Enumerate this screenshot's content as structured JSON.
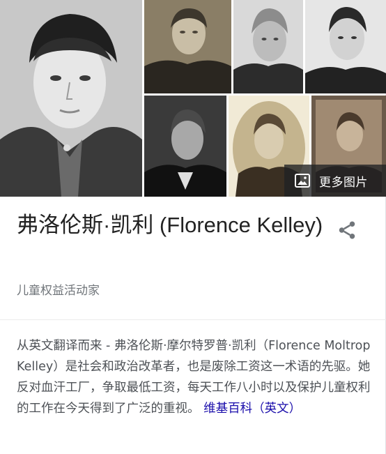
{
  "entity": {
    "title": "弗洛伦斯·凯利 (Florence Kelley)",
    "subtitle": "儿童权益活动家"
  },
  "images": {
    "more_label": "更多图片"
  },
  "description": {
    "text": "从英文翻译而来 - 弗洛伦斯·摩尔特罗普·凯利（Florence Moltrop Kelley）是社会和政治改革者，也是废除工资这一术语的先驱。她反对血汗工厂，争取最低工资，每天工作八小时以及保护儿童权利的工作在今天得到了广泛的重视。",
    "source_link": "维基百科（英文）"
  },
  "icons": {
    "share": "share-icon",
    "images": "image-icon"
  },
  "colors": {
    "link": "#1a0dab",
    "subtitle": "#70757a",
    "overlay": "#202124"
  }
}
